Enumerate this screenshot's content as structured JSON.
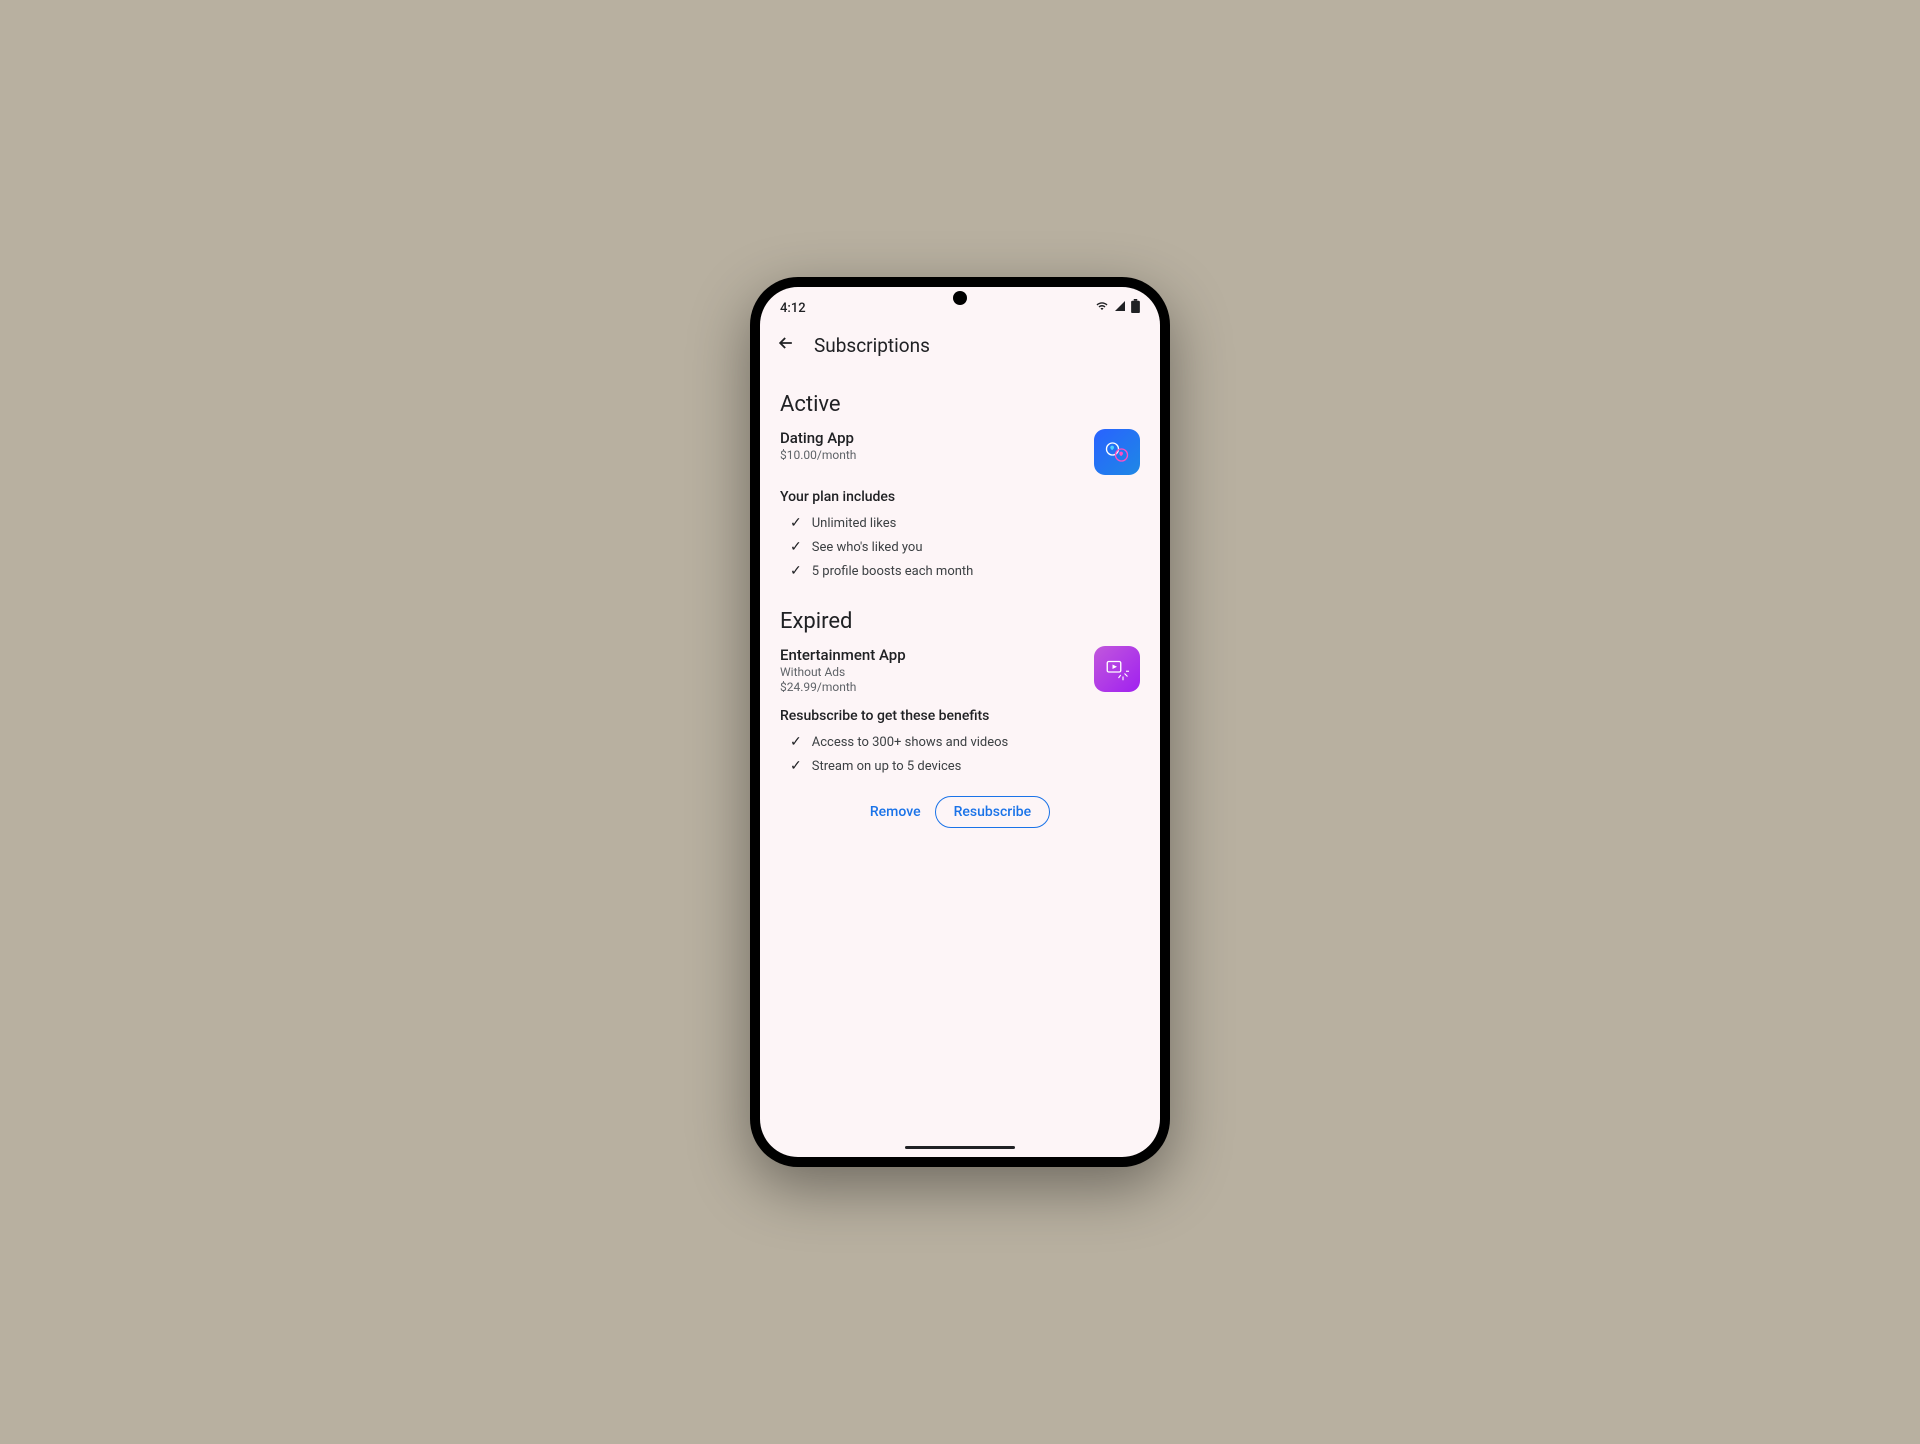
{
  "status_bar": {
    "time": "4:12"
  },
  "header": {
    "title": "Subscriptions"
  },
  "sections": {
    "active": {
      "heading": "Active",
      "app_name": "Dating App",
      "price": "$10.00/month",
      "plan_title": "Your plan includes",
      "features": [
        "Unlimited likes",
        "See who's liked you",
        "5 profile boosts each month"
      ]
    },
    "expired": {
      "heading": "Expired",
      "app_name": "Entertainment App",
      "subtitle": "Without Ads",
      "price": "$24.99/month",
      "plan_title": "Resubscribe to get these benefits",
      "features": [
        "Access to 300+ shows and videos",
        "Stream on up to 5 devices"
      ],
      "remove_label": "Remove",
      "resubscribe_label": "Resubscribe"
    }
  }
}
